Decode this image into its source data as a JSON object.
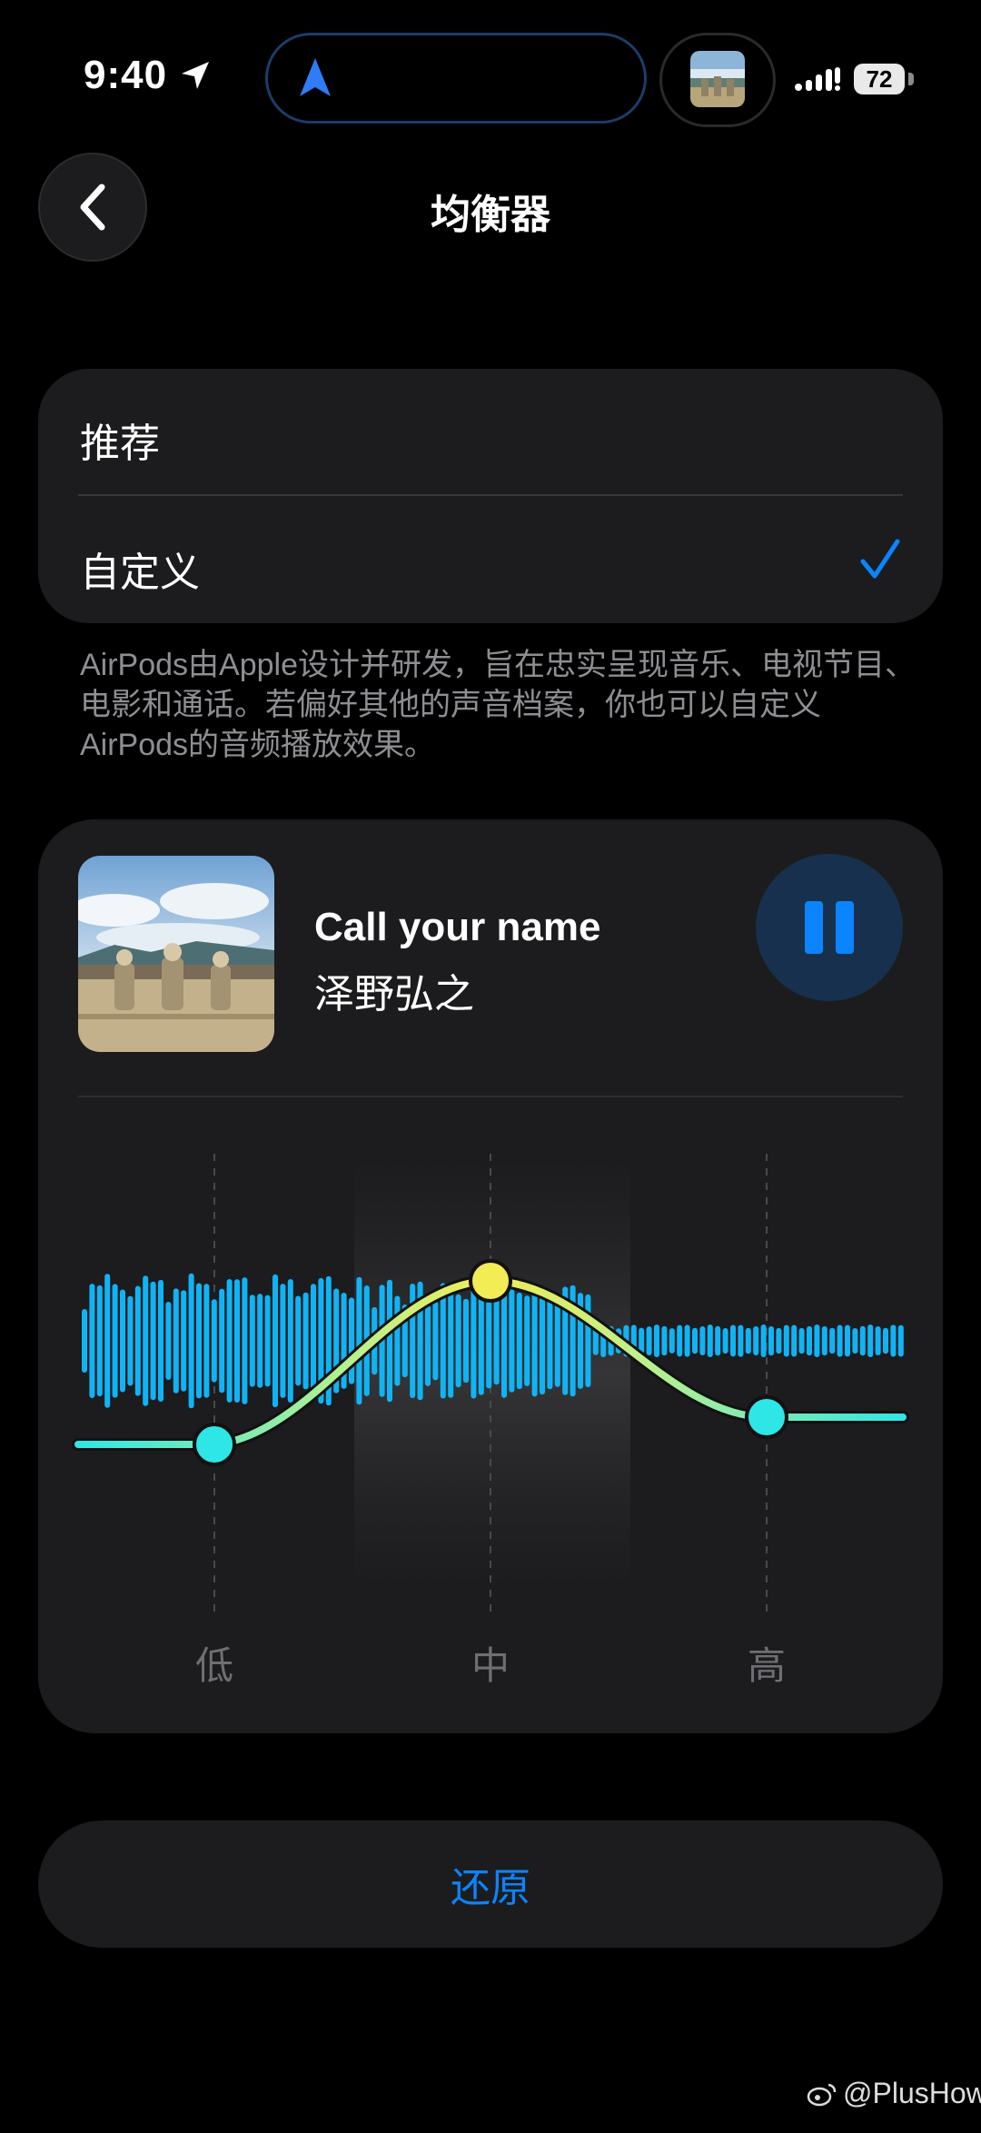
{
  "status_bar": {
    "time": "9:40",
    "battery": "72",
    "icons": [
      "location-arrow-icon",
      "navigation-icon",
      "signal-icon",
      "battery-icon"
    ]
  },
  "nav": {
    "title": "均衡器",
    "back_icon": "chevron-left-icon"
  },
  "options": {
    "items": [
      {
        "label": "推荐",
        "selected": false
      },
      {
        "label": "自定义",
        "selected": true
      }
    ],
    "check_icon": "checkmark-icon"
  },
  "description": "AirPods由Apple设计并研发，旨在忠实呈现音乐、电视节目、电影和通话。若偏好其他的声音档案，你也可以自定义AirPods的音频播放效果。",
  "now_playing": {
    "title": "Call your name",
    "artist": "泽野弘之",
    "state": "playing",
    "control_icon": "pause-icon"
  },
  "equalizer": {
    "bands": [
      {
        "label": "低",
        "level": -0.35
      },
      {
        "label": "中",
        "level": 0.55
      },
      {
        "label": "高",
        "level": -0.2
      }
    ]
  },
  "reset_label": "还原",
  "watermark": "@PlusHow",
  "colors": {
    "accent": "#0a84ff",
    "wave": "#10b4f5",
    "curve_low": "#2ee6e6",
    "curve_high": "#f2ec55",
    "card": "#1c1c1e"
  }
}
